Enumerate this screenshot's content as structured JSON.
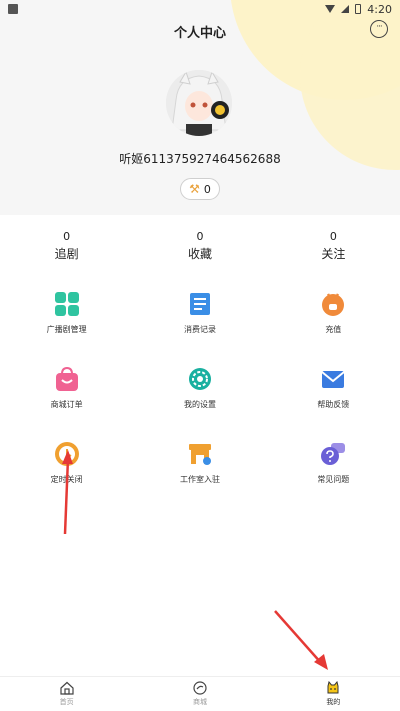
{
  "status_bar": {
    "time": "4:20"
  },
  "header": {
    "title": "个人中心"
  },
  "profile": {
    "name": "听姬611375927464562688",
    "key_count": "0"
  },
  "stats": [
    {
      "value": "0",
      "label": "追剧"
    },
    {
      "value": "0",
      "label": "收藏"
    },
    {
      "value": "0",
      "label": "关注"
    }
  ],
  "menu": [
    {
      "label": "广播剧管理",
      "icon": "grid-tiles-icon",
      "color": "#2fc4a0"
    },
    {
      "label": "消费记录",
      "icon": "receipt-icon",
      "color": "#3a8ee6"
    },
    {
      "label": "充值",
      "icon": "recharge-icon",
      "color": "#f08a3a"
    },
    {
      "label": "商城订单",
      "icon": "shopping-bag-icon",
      "color": "#f06292"
    },
    {
      "label": "我的设置",
      "icon": "settings-gear-icon",
      "color": "#1ab0a0"
    },
    {
      "label": "帮助反馈",
      "icon": "mail-icon",
      "color": "#3a7be0"
    },
    {
      "label": "定时关闭",
      "icon": "clock-timer-icon",
      "color": "#f0a030"
    },
    {
      "label": "工作室入驻",
      "icon": "shop-icon",
      "color": "#f0a030"
    },
    {
      "label": "常见问题",
      "icon": "faq-chat-icon",
      "color": "#6a5fd6"
    }
  ],
  "bottom_nav": [
    {
      "label": "首页",
      "icon": "home-icon"
    },
    {
      "label": "商城",
      "icon": "store-icon"
    },
    {
      "label": "我的",
      "icon": "cat-profile-icon",
      "active": true
    }
  ]
}
